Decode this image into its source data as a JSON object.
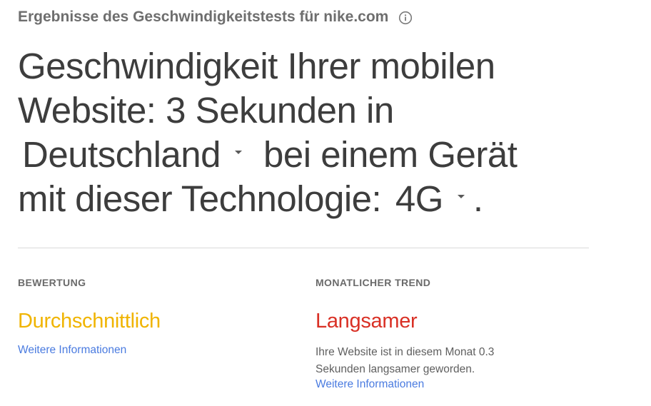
{
  "header": {
    "subtitle": "Ergebnisse des Geschwindigkeitstests für nike.com",
    "info_icon": "info-icon"
  },
  "headline": {
    "line1": "Geschwindigkeit Ihrer mobilen",
    "line2": "Website: 3 Sekunden in",
    "country_value": "Deutschland",
    "line3_rest": "bei einem Gerät",
    "line4_prefix": "mit dieser Technologie:",
    "network_value": "4G",
    "line4_suffix": "."
  },
  "rating": {
    "label": "BEWERTUNG",
    "value": "Durchschnittlich",
    "value_color": "#f0b400",
    "link": "Weitere Informationen"
  },
  "trend": {
    "label": "MONATLICHER TREND",
    "value": "Langsamer",
    "value_color": "#d93025",
    "description": "Ihre Website ist in diesem Monat 0.3 Sekunden langsamer geworden.",
    "link": "Weitere Informationen"
  },
  "colors": {
    "link": "#4a7be0",
    "text": "#3d3d3d"
  }
}
